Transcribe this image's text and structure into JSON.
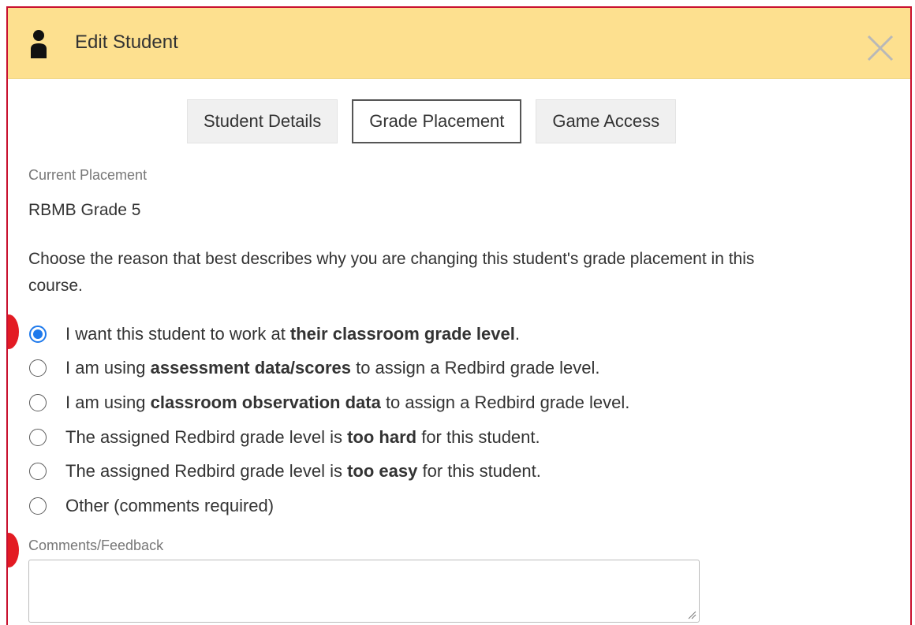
{
  "header": {
    "title": "Edit Student",
    "icon": "person-icon",
    "close_icon": "close-icon",
    "background_color": "#fde08f"
  },
  "tabs": [
    {
      "label": "Student Details",
      "active": false
    },
    {
      "label": "Grade Placement",
      "active": true
    },
    {
      "label": "Game Access",
      "active": false
    }
  ],
  "placement": {
    "label": "Current Placement",
    "value": "RBMB Grade 5"
  },
  "instructions": "Choose the reason that best describes why you are changing this student's grade placement in this course.",
  "options": [
    {
      "before": "I want this student to work at ",
      "bold": "their classroom grade level",
      "after": ".",
      "checked": true
    },
    {
      "before": "I am using ",
      "bold": "assessment data/scores",
      "after": " to assign a Redbird grade level.",
      "checked": false
    },
    {
      "before": "I am using ",
      "bold": "classroom observation data",
      "after": " to assign a Redbird grade level.",
      "checked": false
    },
    {
      "before": "The assigned Redbird grade level is ",
      "bold": "too hard",
      "after": " for this student.",
      "checked": false
    },
    {
      "before": "The assigned Redbird grade level is ",
      "bold": "too easy",
      "after": " for this student.",
      "checked": false
    },
    {
      "before": "Other (comments required)",
      "bold": "",
      "after": "",
      "checked": false
    }
  ],
  "comments": {
    "label": "Comments/Feedback",
    "value": "",
    "placeholder": ""
  },
  "colors": {
    "frame_border": "#c8102e",
    "radio_selected": "#1f7aec",
    "marker": "#e31b23"
  }
}
